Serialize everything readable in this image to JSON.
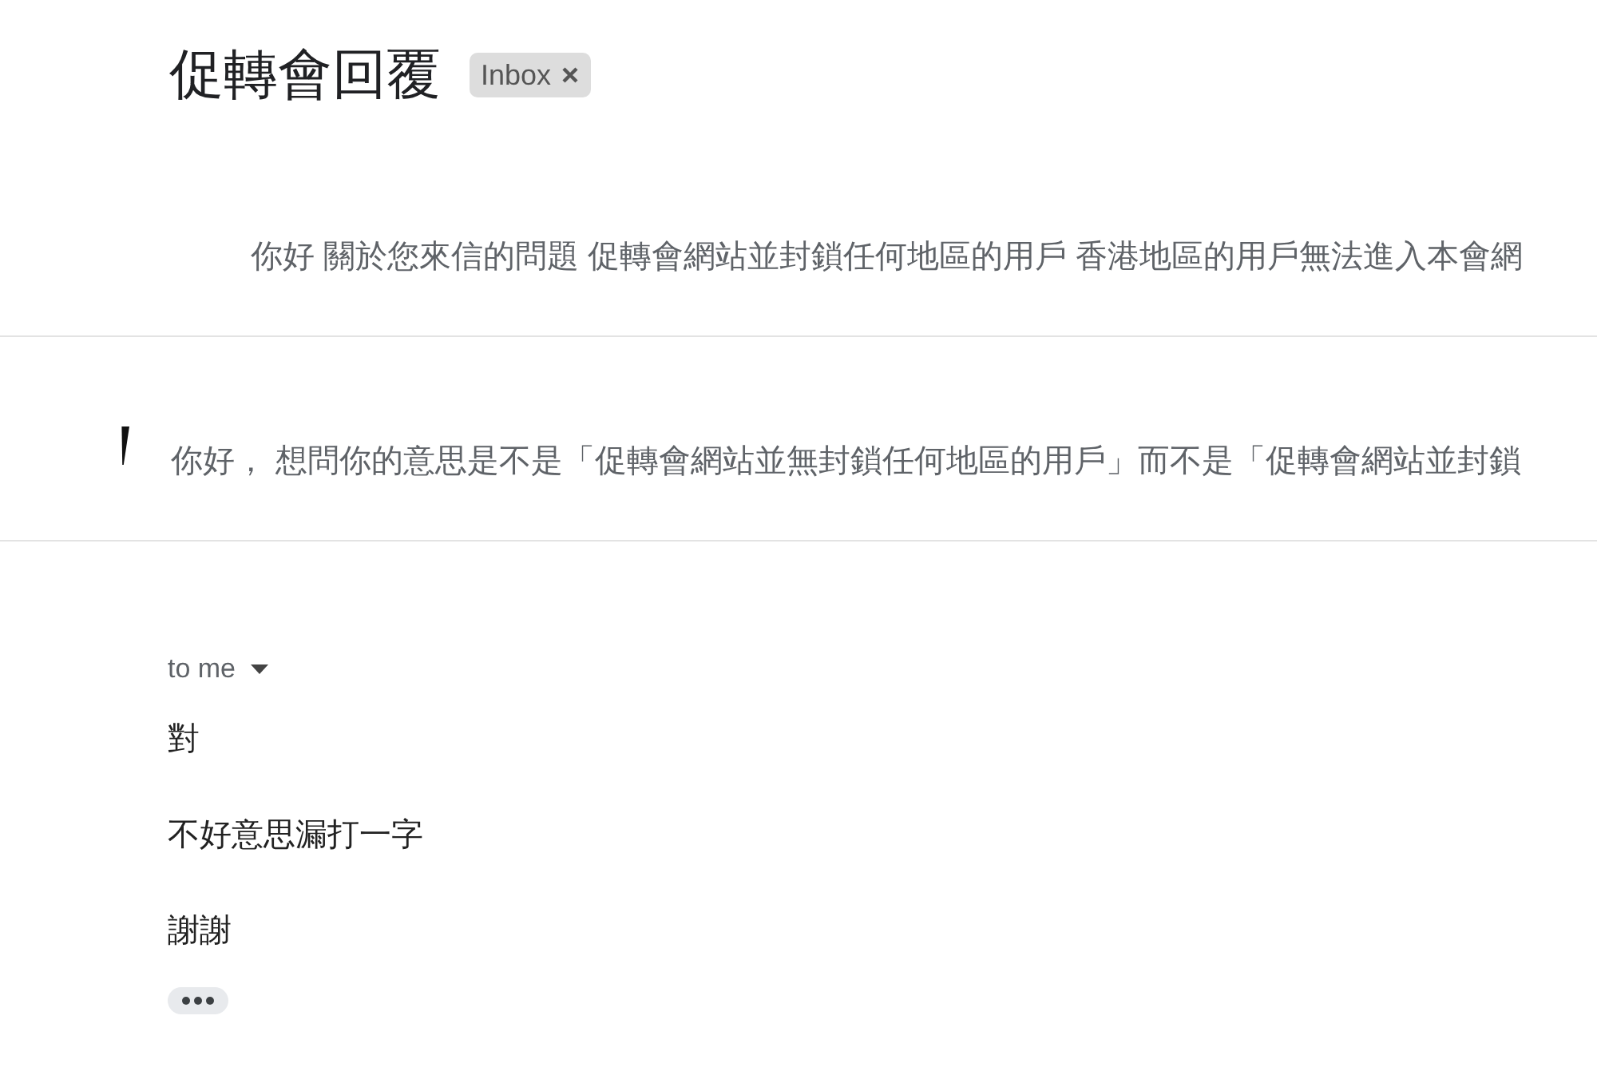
{
  "subject": {
    "title": "促轉會回覆",
    "label": "Inbox"
  },
  "messages": [
    {
      "kind": "collapsed",
      "snippet": "你好 關於您來信的問題 促轉會網站並封鎖任何地區的用戶 香港地區的用戶無法進入本會網"
    },
    {
      "kind": "collapsed",
      "snippet": "你好， 想問你的意思是不是「促轉會網站並無封鎖任何地區的用戶」而不是「促轉會網站並封鎖"
    },
    {
      "kind": "expanded",
      "recipient": "to me",
      "body": [
        "對",
        "不好意思漏打一字",
        "謝謝"
      ]
    }
  ]
}
